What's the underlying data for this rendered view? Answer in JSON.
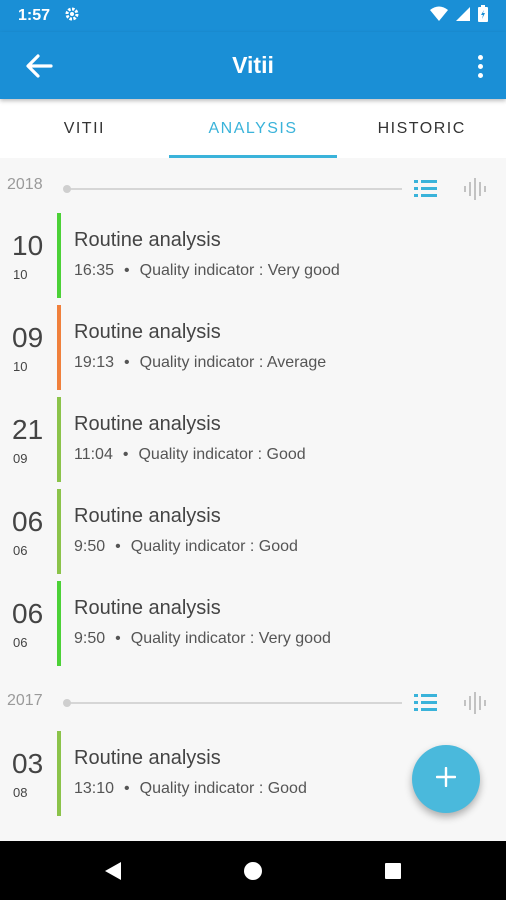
{
  "status_bar": {
    "time": "1:57",
    "icons": [
      "settings-icon",
      "wifi-icon",
      "cell-signal-icon",
      "battery-icon"
    ]
  },
  "app_bar": {
    "title": "Vitii",
    "back_icon": "arrow-back-icon",
    "menu_icon": "more-vert-icon"
  },
  "tabs": [
    {
      "label": "VITII",
      "active": false
    },
    {
      "label": "ANALYSIS",
      "active": true
    },
    {
      "label": "HISTORIC",
      "active": false
    }
  ],
  "groups": [
    {
      "year": "2018",
      "entries": [
        {
          "day": "10",
          "month": "10",
          "name": "Routine analysis",
          "time": "16:35",
          "quality": "Quality indicator : Very good",
          "color": "#4cd137"
        },
        {
          "day": "09",
          "month": "10",
          "name": "Routine analysis",
          "time": "19:13",
          "quality": "Quality indicator : Average",
          "color": "#f0803c"
        },
        {
          "day": "21",
          "month": "09",
          "name": "Routine analysis",
          "time": "11:04",
          "quality": "Quality indicator : Good",
          "color": "#8bc34a"
        },
        {
          "day": "06",
          "month": "06",
          "name": "Routine analysis",
          "time": "9:50",
          "quality": "Quality indicator : Good",
          "color": "#8bc34a"
        },
        {
          "day": "06",
          "month": "06",
          "name": "Routine analysis",
          "time": "9:50",
          "quality": "Quality indicator : Very good",
          "color": "#4cd137"
        }
      ]
    },
    {
      "year": "2017",
      "entries": [
        {
          "day": "03",
          "month": "08",
          "name": "Routine analysis",
          "time": "13:10",
          "quality": "Quality indicator : Good",
          "color": "#8bc34a"
        }
      ]
    }
  ],
  "fab": {
    "icon": "add-icon"
  },
  "colors": {
    "primary": "#1a8fd6",
    "accent": "#3ab3da",
    "fab": "#4ab9dc"
  },
  "nav_bar": [
    "back-triangle-icon",
    "home-circle-icon",
    "recents-square-icon"
  ]
}
